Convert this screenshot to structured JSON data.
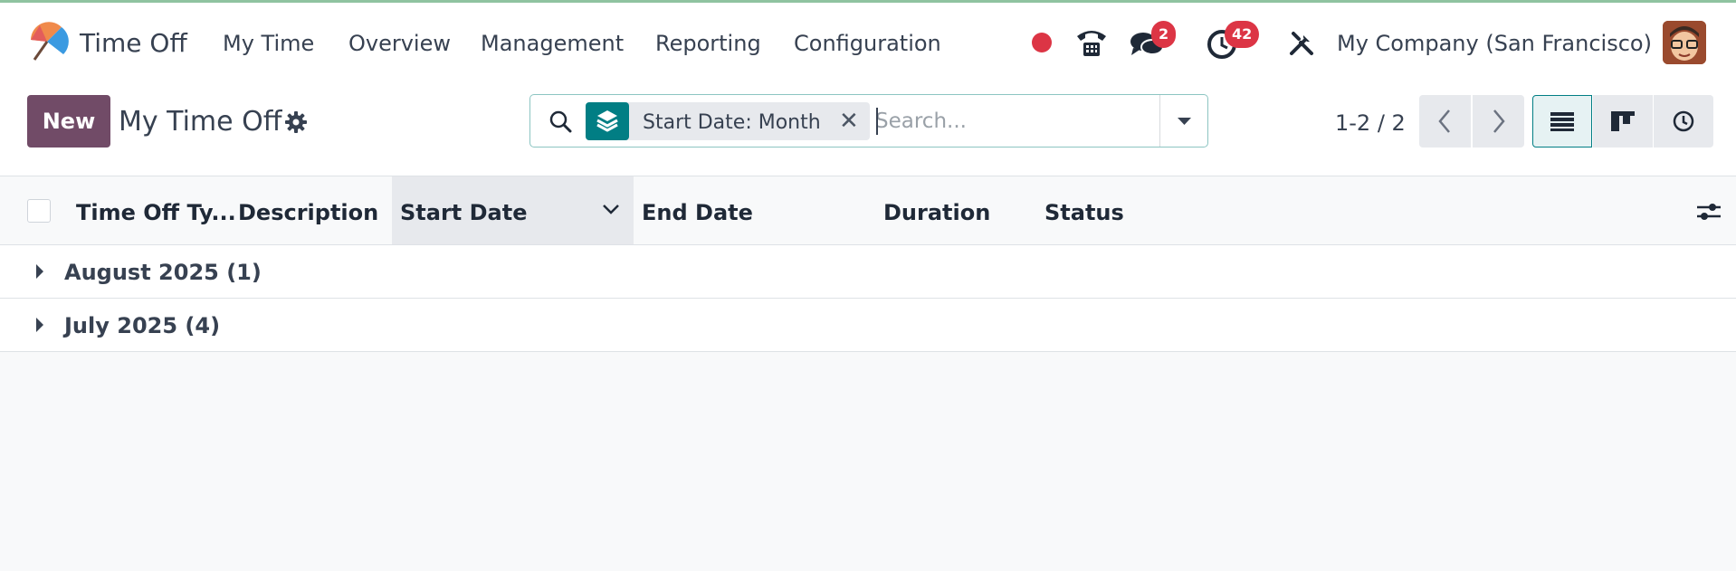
{
  "app": {
    "name": "Time Off",
    "menu": [
      "My Time",
      "Overview",
      "Management",
      "Reporting",
      "Configuration"
    ]
  },
  "systray": {
    "status_color": "#dc3545",
    "messages_count": "2",
    "activities_count": "42",
    "company": "My Company (San Francisco)"
  },
  "control_panel": {
    "new_label": "New",
    "title": "My Time Off",
    "facet_label": "Start Date: Month",
    "search_placeholder": "Search...",
    "pager": "1-2 / 2"
  },
  "list": {
    "columns": [
      "Time Off Ty...",
      "Description",
      "Start Date",
      "End Date",
      "Duration",
      "Status"
    ],
    "sorted_column": "Start Date",
    "groups": [
      {
        "label": "August 2025 (1)"
      },
      {
        "label": "July 2025 (4)"
      }
    ]
  },
  "colors": {
    "brand": "#714b67",
    "accent": "#017e84",
    "badge": "#dc3545"
  }
}
